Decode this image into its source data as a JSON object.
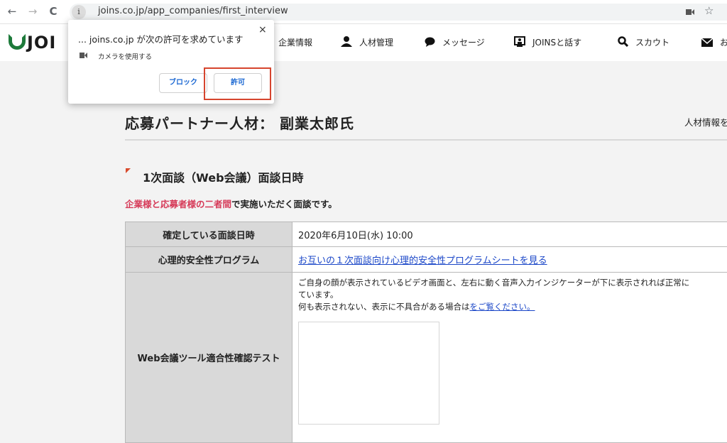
{
  "browser": {
    "url": "joins.co.jp/app_companies/first_interview",
    "back_icon": "←",
    "forward_icon": "→",
    "reload_icon": "C",
    "info_icon": "i",
    "star_icon": "☆"
  },
  "site": {
    "logo_text": "JOI",
    "nav": [
      {
        "label": "企業情報",
        "icon": ""
      },
      {
        "label": "人材管理",
        "icon": "person-icon"
      },
      {
        "label": "メッセージ",
        "icon": "chat-bubble-icon"
      },
      {
        "label": "JOINSと話す",
        "icon": "support-icon"
      },
      {
        "label": "スカウト",
        "icon": "search-icon"
      },
      {
        "label": "お",
        "icon": "mail-icon"
      }
    ]
  },
  "page": {
    "title": "応募パートナー人材： 副業太郎氏",
    "side_link": "人材情報を",
    "section_title": "1次面談（Web会議）面談日時",
    "lead_highlight": "企業様と応募者様の二者間",
    "lead_rest": "で実施いただく面談です。",
    "rows": [
      {
        "label": "確定している面談日時",
        "value": "2020年6月10日(水) 10:00"
      },
      {
        "label": "心理的安全性プログラム",
        "value": "お互いの１次面談向け心理的安全性プログラムシートを見る"
      },
      {
        "label": "Web会議ツール適合性確認テスト",
        "line1": "ご自身の顔が表示されているビデオ画面と、左右に動く音声入力インジケーターが下に表示されれば正常に",
        "line2": "ています。",
        "line3_pre": "何も表示されない、表示に不具合がある場合は",
        "line3_link": "をご覧ください。"
      }
    ]
  },
  "popup": {
    "title": "... joins.co.jp  が次の許可を求めています",
    "permission": "カメラを使用する",
    "close_icon": "×",
    "block_label": "ブロック",
    "allow_label": "許可"
  },
  "colors": {
    "accent": "#d63a58",
    "highlight_border": "#d6452e",
    "link": "#1b47c8",
    "button_text": "#1a67d2"
  }
}
